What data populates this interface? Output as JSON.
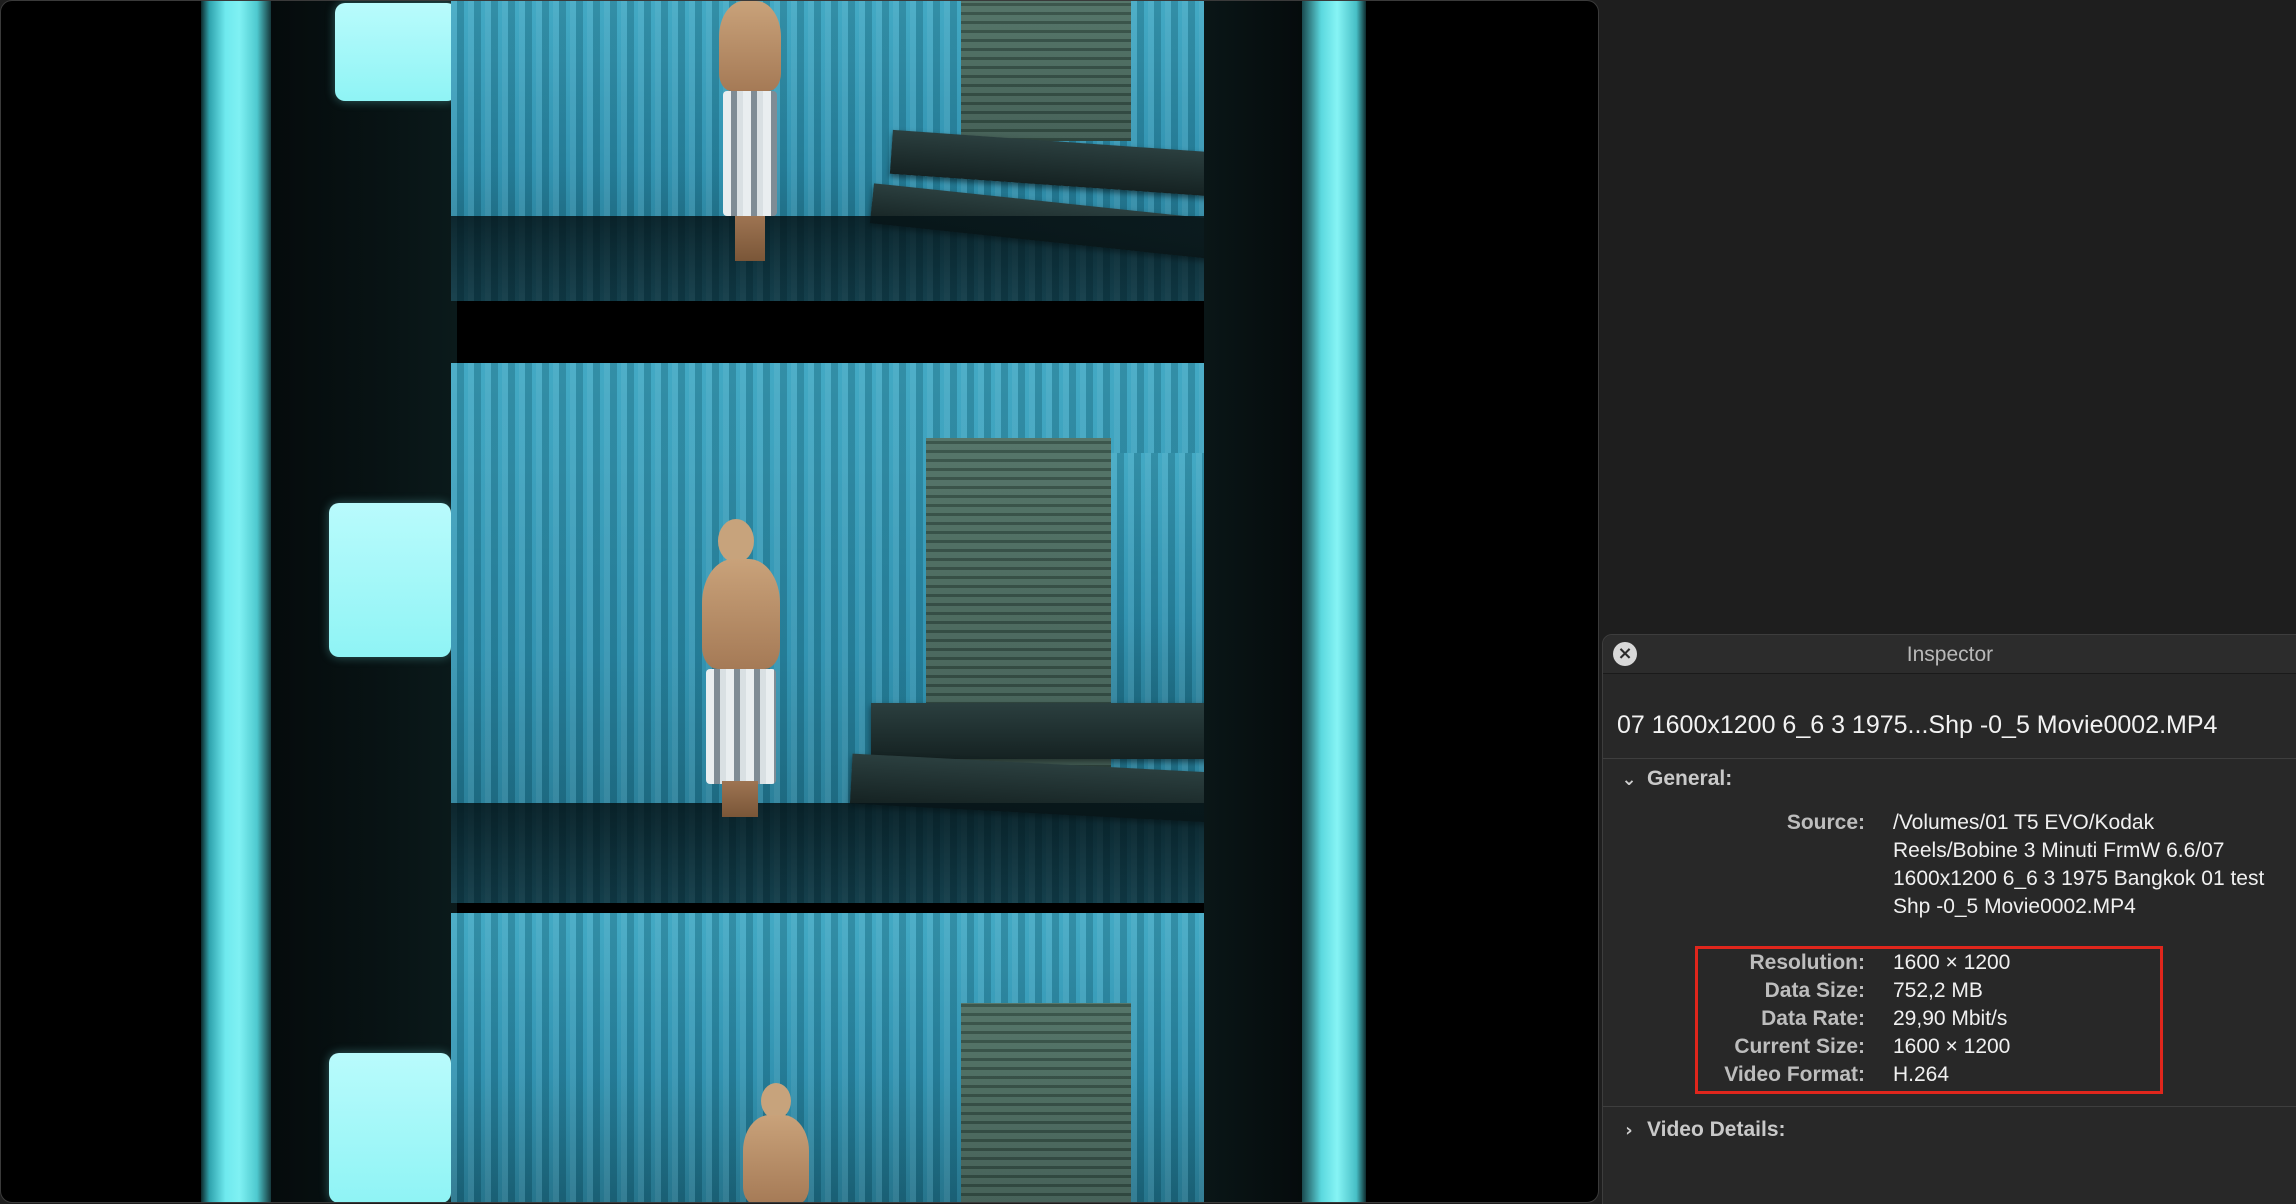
{
  "inspector": {
    "title": "Inspector",
    "file_name": "07 1600x1200 6_6 3 1975...Shp -0_5 Movie0002.MP4",
    "close_icon": "close-icon",
    "general": {
      "heading": "General:",
      "expanded": true,
      "rows": [
        {
          "label": "Source:",
          "value": "/Volumes/01 T5 EVO/Kodak Reels/Bobine 3 Minuti FrmW 6.6/07 1600x1200 6_6 3 1975 Bangkok 01 test Shp -0_5 Movie0002.MP4"
        },
        {
          "label": "Resolution:",
          "value": "1600 × 1200"
        },
        {
          "label": "Data Size:",
          "value": "752,2 MB"
        },
        {
          "label": "Data Rate:",
          "value": "29,90 Mbit/s"
        },
        {
          "label": "Current Size:",
          "value": "1600 × 1200"
        },
        {
          "label": "Video Format:",
          "value": "H.264"
        }
      ]
    },
    "video_details": {
      "heading": "Video Details:",
      "expanded": false
    }
  },
  "colors": {
    "highlight": "#e0261c",
    "panel_bg": "#282828",
    "film_cyan": "#7ff1f3"
  }
}
